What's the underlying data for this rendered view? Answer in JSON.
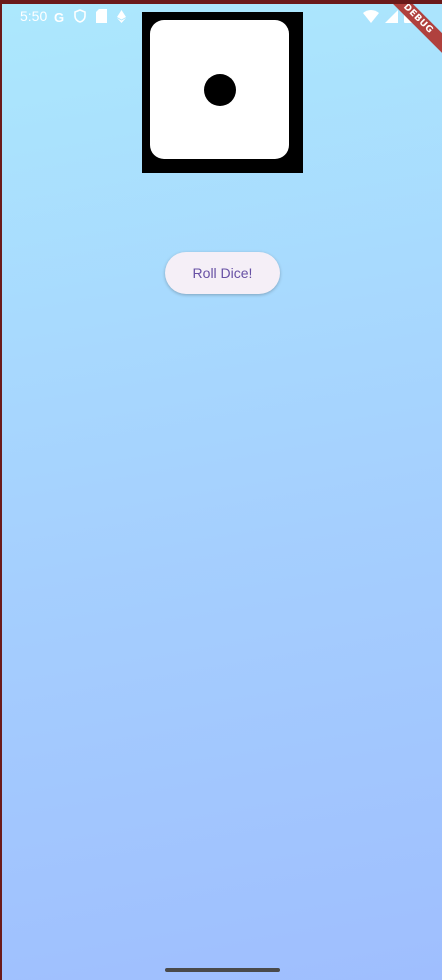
{
  "status_bar": {
    "time": "5:50",
    "left_icons": [
      "google-icon",
      "shield-icon",
      "sim-card-icon",
      "ethereum-icon"
    ],
    "right_icons": [
      "wifi-icon",
      "signal-icon",
      "battery-icon"
    ]
  },
  "debug_banner": {
    "label": "DEBUG",
    "color": "#b0413e"
  },
  "dice": {
    "value": 1
  },
  "button": {
    "label": "Roll Dice!"
  },
  "theme": {
    "gradient_top": "#ace8fd",
    "gradient_bottom": "#9fbefe",
    "button_text_color": "#6750a4"
  }
}
